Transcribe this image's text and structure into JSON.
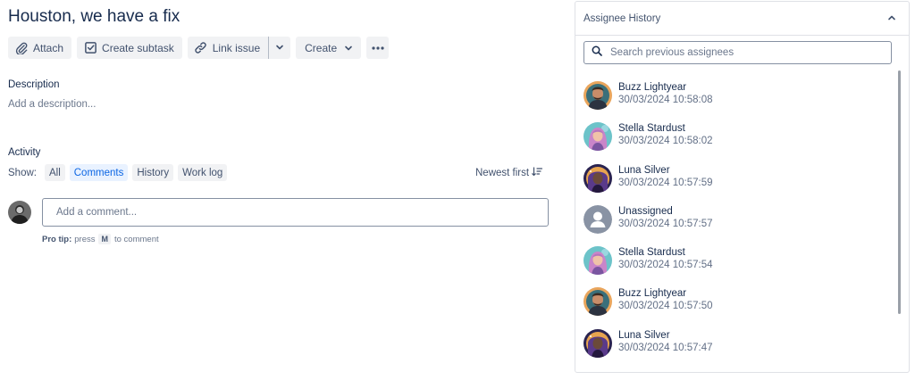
{
  "issue": {
    "title": "Houston, we have a fix"
  },
  "toolbar": {
    "attach": "Attach",
    "create_subtask": "Create subtask",
    "link_issue": "Link issue",
    "create": "Create"
  },
  "description": {
    "label": "Description",
    "placeholder": "Add a description..."
  },
  "activity": {
    "label": "Activity",
    "show_label": "Show:",
    "filters": [
      "All",
      "Comments",
      "History",
      "Work log"
    ],
    "active_filter": "Comments",
    "sort": "Newest first"
  },
  "comment": {
    "placeholder": "Add a comment...",
    "protip_label": "Pro tip:",
    "protip_press": "press",
    "protip_key": "M",
    "protip_suffix": "to comment"
  },
  "assignee_history": {
    "title": "Assignee History",
    "search_placeholder": "Search previous assignees",
    "items": [
      {
        "name": "Buzz Lightyear",
        "time": "30/03/2024 10:58:08",
        "avatar": "buzz"
      },
      {
        "name": "Stella Stardust",
        "time": "30/03/2024 10:58:02",
        "avatar": "stella"
      },
      {
        "name": "Luna Silver",
        "time": "30/03/2024 10:57:59",
        "avatar": "luna"
      },
      {
        "name": "Unassigned",
        "time": "30/03/2024 10:57:57",
        "avatar": "unassigned"
      },
      {
        "name": "Stella Stardust",
        "time": "30/03/2024 10:57:54",
        "avatar": "stella"
      },
      {
        "name": "Buzz Lightyear",
        "time": "30/03/2024 10:57:50",
        "avatar": "buzz"
      },
      {
        "name": "Luna Silver",
        "time": "30/03/2024 10:57:47",
        "avatar": "luna"
      }
    ]
  },
  "colors": {
    "accent": "#0c66e4",
    "active_chip_bg": "#e9f2ff",
    "button_bg": "#f1f2f4",
    "text": "#172b4d"
  }
}
